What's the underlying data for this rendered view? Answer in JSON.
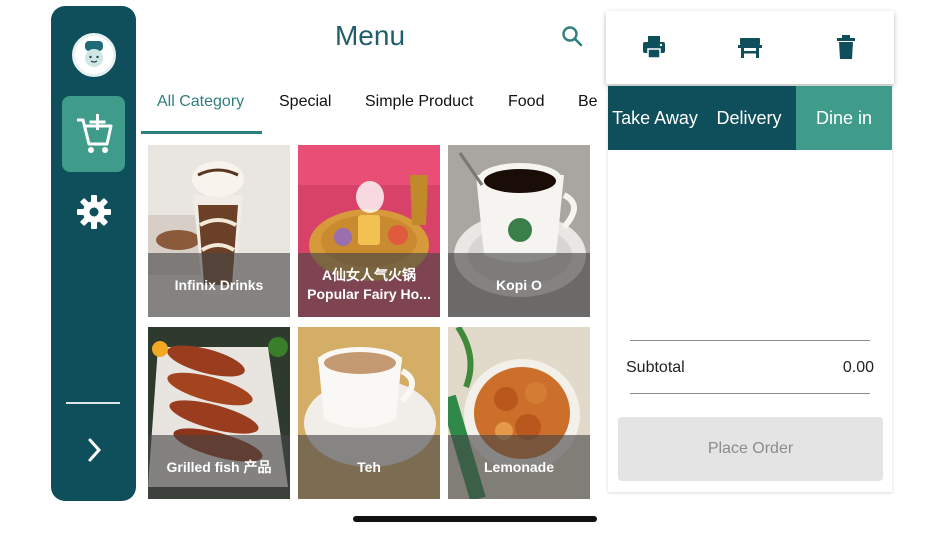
{
  "header": {
    "title": "Menu"
  },
  "icons": {
    "search": "search-icon",
    "avatar": "chef-avatar",
    "add_cart": "add-to-cart-icon",
    "settings": "gear-icon",
    "expand": "chevron-right-icon",
    "print": "printer-icon",
    "table": "table-icon",
    "delete": "trash-icon"
  },
  "categories": [
    {
      "label": "All Category",
      "active": true
    },
    {
      "label": "Special"
    },
    {
      "label": "Simple Product"
    },
    {
      "label": "Food"
    },
    {
      "label": "Be"
    }
  ],
  "products": [
    {
      "name": "Infinix Drinks"
    },
    {
      "name": "A仙女人气火锅 Popular Fairy Ho..."
    },
    {
      "name": "Kopi O"
    },
    {
      "name": "Grilled fish 产品"
    },
    {
      "name": "Teh"
    },
    {
      "name": "Lemonade"
    }
  ],
  "order": {
    "types": [
      "Take Away",
      "Delivery",
      "Dine in"
    ],
    "selected_type": "Dine in",
    "subtotal_label": "Subtotal",
    "subtotal_value": "0.00",
    "place_order_label": "Place Order"
  },
  "colors": {
    "primary": "#0f4f5b",
    "accent": "#3f9c8b",
    "text_accent": "#2e7f7d"
  }
}
